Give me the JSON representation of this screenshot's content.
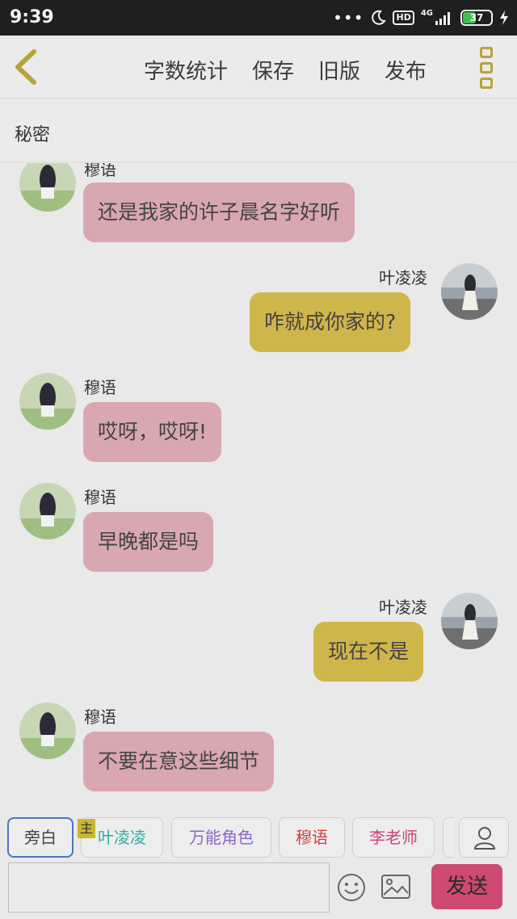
{
  "status_bar": {
    "time": "9:39",
    "dots": "•••",
    "hd": "HD",
    "network": "4G",
    "battery": "37"
  },
  "toolbar": {
    "actions": [
      "字数统计",
      "保存",
      "旧版",
      "发布"
    ]
  },
  "secret_label": "秘密",
  "messages": [
    {
      "side": "left",
      "name": "穆语",
      "text": "还是我家的许子晨名字好听"
    },
    {
      "side": "right",
      "name": "叶凌凌",
      "text": "咋就成你家的?"
    },
    {
      "side": "left",
      "name": "穆语",
      "text": "哎呀，哎呀!"
    },
    {
      "side": "left",
      "name": "穆语",
      "text": "早晚都是吗"
    },
    {
      "side": "right",
      "name": "叶凌凌",
      "text": "现在不是"
    },
    {
      "side": "left",
      "name": "穆语",
      "text": "不要在意这些细节"
    }
  ],
  "roles": {
    "narration": "旁白",
    "main_badge": "主",
    "items": [
      {
        "label": "叶凌凌",
        "color": "#2fae9d"
      },
      {
        "label": "万能角色",
        "color": "#8a66c6"
      },
      {
        "label": "穆语",
        "color": "#d04040"
      },
      {
        "label": "李老师",
        "color": "#d0407a"
      }
    ]
  },
  "input": {
    "value": "",
    "placeholder": ""
  },
  "send_label": "发送",
  "colors": {
    "left_bubble": "#d9a7b0",
    "right_bubble": "#cfb64a",
    "send_button": "#cf4a73",
    "accent": "#b7a33c"
  }
}
